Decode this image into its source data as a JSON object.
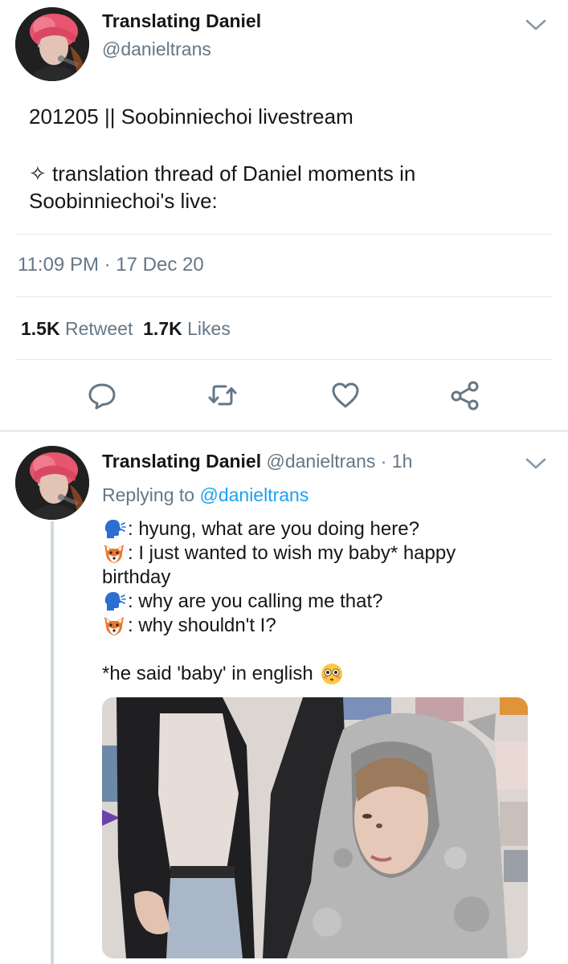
{
  "main_tweet": {
    "display_name": "Translating Daniel",
    "handle": "@danieltrans",
    "text_line1": "201205 || Soobinniechoi livestream",
    "text_line2": "✧ translation thread of Daniel moments in",
    "text_line3": "Soobinniechoi's live:",
    "timestamp": "11:09 PM · 17 Dec 20",
    "retweets_count": "1.5K",
    "retweets_label": "Retweet",
    "likes_count": "1.7K",
    "likes_label": "Likes",
    "actions": [
      "reply-icon",
      "retweet-icon",
      "like-icon",
      "share-icon"
    ]
  },
  "reply_tweet": {
    "display_name": "Translating Daniel",
    "handle_time": "@danieltrans · 1h",
    "replying_prefix": "Replying to",
    "replying_to": "@danieltrans",
    "lines": [
      {
        "icon": "speaking-head-icon",
        "text": ": hyung, what are you doing here?"
      },
      {
        "icon": "fox-face-icon",
        "text": ": I just wanted to wish my baby* happy"
      },
      {
        "icon": "",
        "text": "birthday"
      },
      {
        "icon": "speaking-head-icon",
        "text": ": why are you calling me that?"
      },
      {
        "icon": "fox-face-icon",
        "text": ": why shouldn't I?"
      }
    ],
    "note": "*he said 'baby' in english",
    "note_icon": "flushed-face-icon"
  },
  "colors": {
    "text": "#14171a",
    "secondary": "#657786",
    "link": "#1da1f2",
    "divider": "#e1e8ed"
  }
}
